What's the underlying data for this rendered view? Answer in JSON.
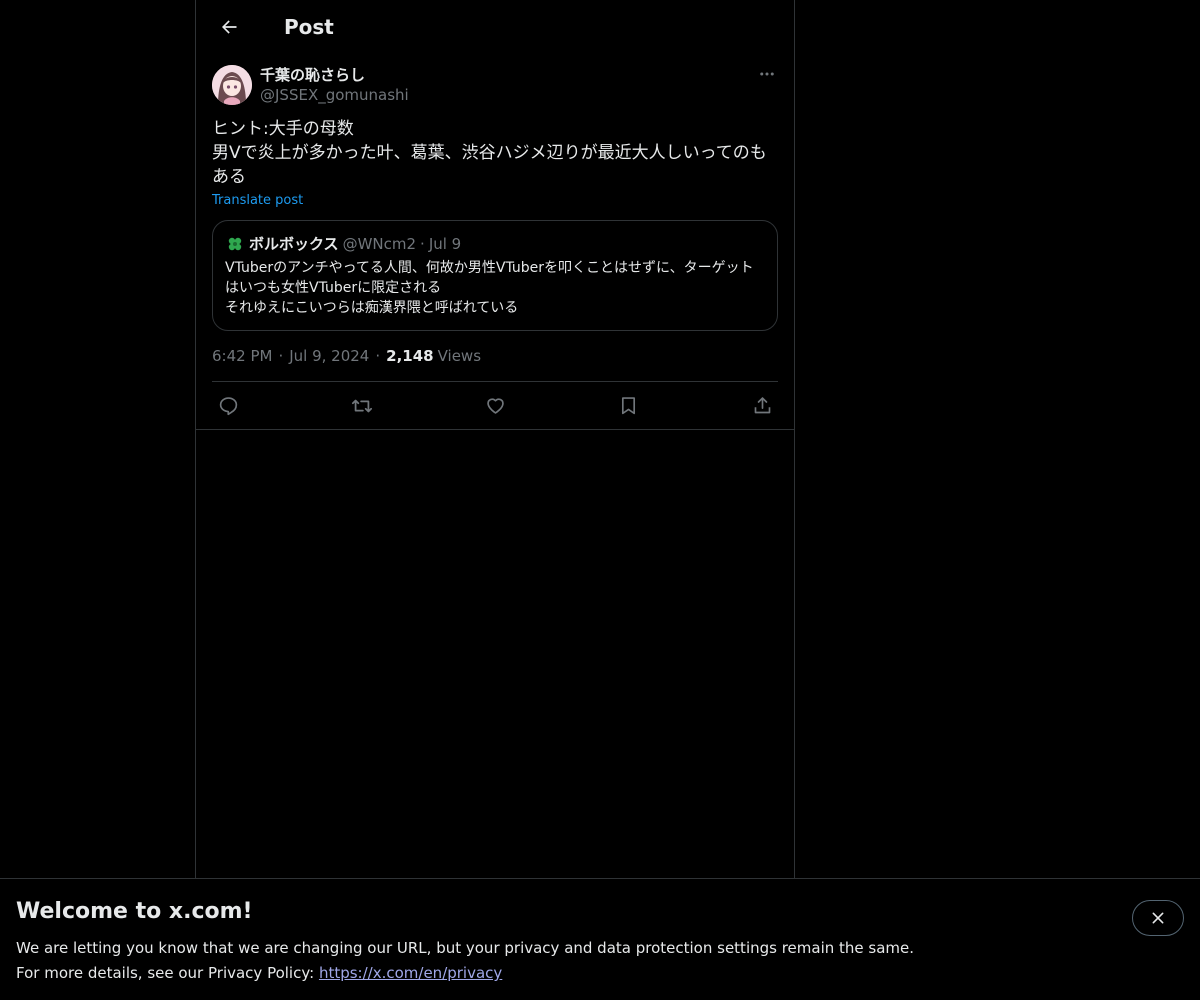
{
  "header": {
    "title": "Post"
  },
  "post": {
    "author": {
      "display_name": "千葉の恥さらし",
      "handle": "@JSSEX_gomunashi"
    },
    "text": "ヒント:大手の母数\n男Vで炎上が多かった叶、葛葉、渋谷ハジメ辺りが最近大人しいってのもある",
    "translate_label": "Translate post",
    "quote": {
      "display_name": "ボルボックス",
      "handle": "@WNcm2",
      "date": "Jul 9",
      "text": "VTuberのアンチやってる人間、何故か男性VTuberを叩くことはせずに、ターゲットはいつも女性VTuberに限定される\nそれゆえにこいつらは痴漢界隈と呼ばれている"
    },
    "time": "6:42 PM",
    "date": "Jul 9, 2024",
    "views_count": "2,148",
    "views_label": "Views",
    "separator": "·"
  },
  "actions": {
    "icons": [
      "reply-icon",
      "repost-icon",
      "like-icon",
      "bookmark-icon",
      "share-icon"
    ]
  },
  "banner": {
    "title": "Welcome to x.com!",
    "line1": "We are letting you know that we are changing our URL, but your privacy and data protection settings remain the same.",
    "line2_prefix": "For more details, see our Privacy Policy: ",
    "link": "https://x.com/en/privacy"
  },
  "colors": {
    "accent": "#1d9bf0",
    "muted": "#71767b",
    "border": "#2f3336",
    "text": "#e7e9ea"
  }
}
